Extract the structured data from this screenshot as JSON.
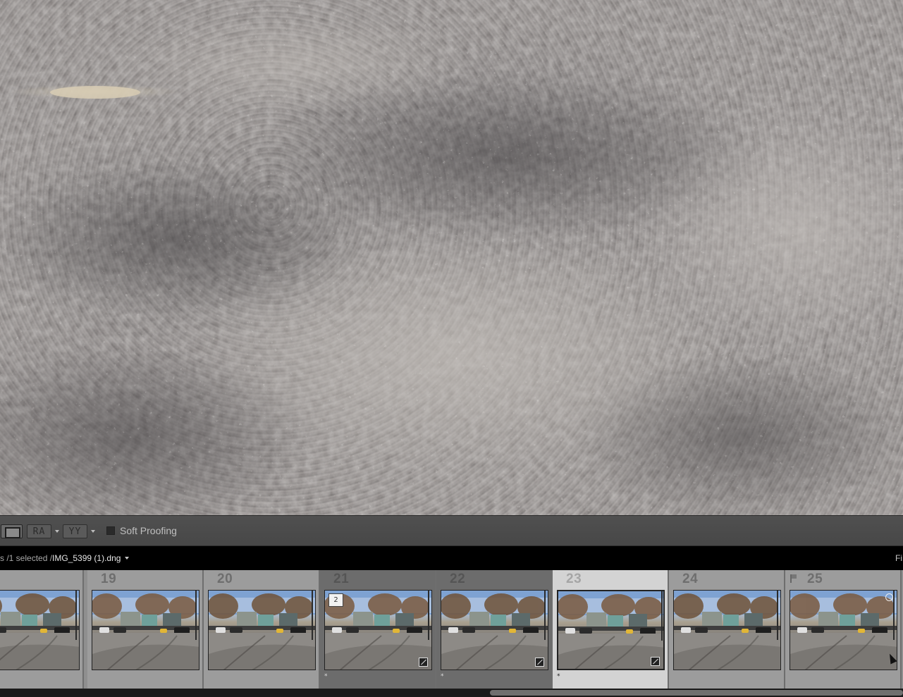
{
  "toolbar": {
    "view_icon": "loupe-view-icon",
    "before_after_label": "RA",
    "compare_label": "YY",
    "soft_proofing_label": "Soft Proofing",
    "soft_proofing_checked": false
  },
  "filmstrip_header": {
    "status_prefix": "s /1 selected /",
    "filename": "IMG_5399 (1).dng",
    "right_label": "Fi"
  },
  "filmstrip": {
    "cells": [
      {
        "number": "",
        "grouped": false,
        "active": false
      },
      {
        "number": "19",
        "grouped": false,
        "active": false
      },
      {
        "number": "20",
        "grouped": false,
        "active": false
      },
      {
        "number": "21",
        "grouped": true,
        "active": false,
        "stack_count": "2",
        "edited": true,
        "star": "*"
      },
      {
        "number": "22",
        "grouped": true,
        "active": false,
        "edited": true,
        "star": "*"
      },
      {
        "number": "23",
        "grouped": false,
        "active": true,
        "edited": true,
        "star": "*"
      },
      {
        "number": "24",
        "grouped": false,
        "active": false
      },
      {
        "number": "25",
        "grouped": false,
        "active": false,
        "flagged": true
      }
    ]
  },
  "colors": {
    "toolbar_bg": "#4c4c4c",
    "filmstrip_bg": "#9c9c9c",
    "group_bg": "#6c6c6c",
    "active_bg": "#d3d3d3"
  }
}
